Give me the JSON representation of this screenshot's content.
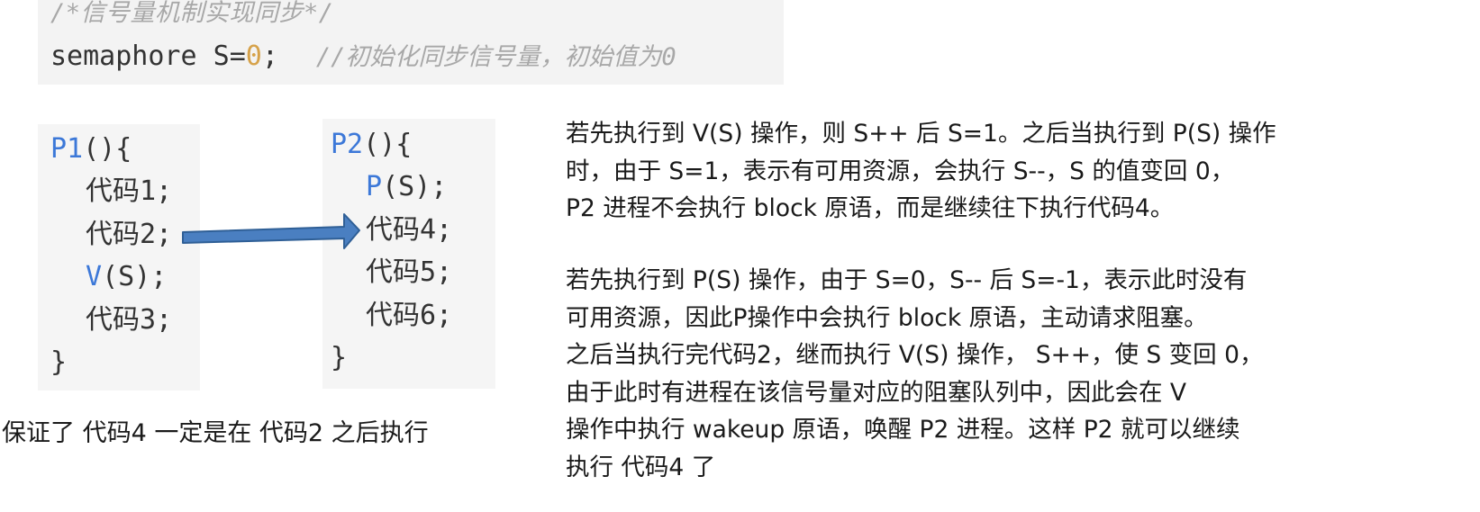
{
  "header": {
    "comment": "/*信号量机制实现同步*/",
    "decl_prefix": "semaphore S",
    "decl_eq": "=",
    "decl_value": "0",
    "decl_semicolon": ";",
    "decl_comment": "//初始化同步信号量，初始值为0"
  },
  "p1": {
    "name": "P1",
    "open": "(){",
    "lines": [
      "代码1;",
      "代码2;"
    ],
    "v_kw": "V",
    "v_rest": "(S);",
    "after": [
      "代码3;"
    ],
    "close": "}"
  },
  "p2": {
    "name": "P2",
    "open": "(){",
    "p_kw": "P",
    "p_rest": "(S);",
    "lines": [
      "代码4;",
      "代码5;",
      "代码6;"
    ],
    "close": "}"
  },
  "conclusion": "保证了 代码4 一定是在 代码2 之后执行",
  "explanation": {
    "para1": [
      "若先执行到 V(S) 操作，则 S++ 后 S=1。之后当执行到 P(S) 操作",
      "时，由于 S=1，表示有可用资源，会执行 S--，S 的值变回 0，",
      "P2 进程不会执行 block 原语，而是继续往下执行代码4。"
    ],
    "para2": [
      "若先执行到 P(S) 操作，由于 S=0，S-- 后 S=-1，表示此时没有",
      "可用资源，因此P操作中会执行 block 原语，主动请求阻塞。",
      "之后当执行完代码2，继而执行 V(S) 操作， S++，使 S 变回 0，",
      "由于此时有进程在该信号量对应的阻塞队列中，因此会在 V",
      "操作中执行 wakeup 原语，唤醒 P2 进程。这样 P2 就可以继续",
      "执行 代码4 了"
    ]
  },
  "colors": {
    "keyword": "#3c78d8",
    "arrow_fill": "#4a7fc1",
    "arrow_stroke": "#2f5f96",
    "number": "#d6a24a",
    "comment": "#a8a8a8",
    "code_bg": "#f5f5f5"
  }
}
